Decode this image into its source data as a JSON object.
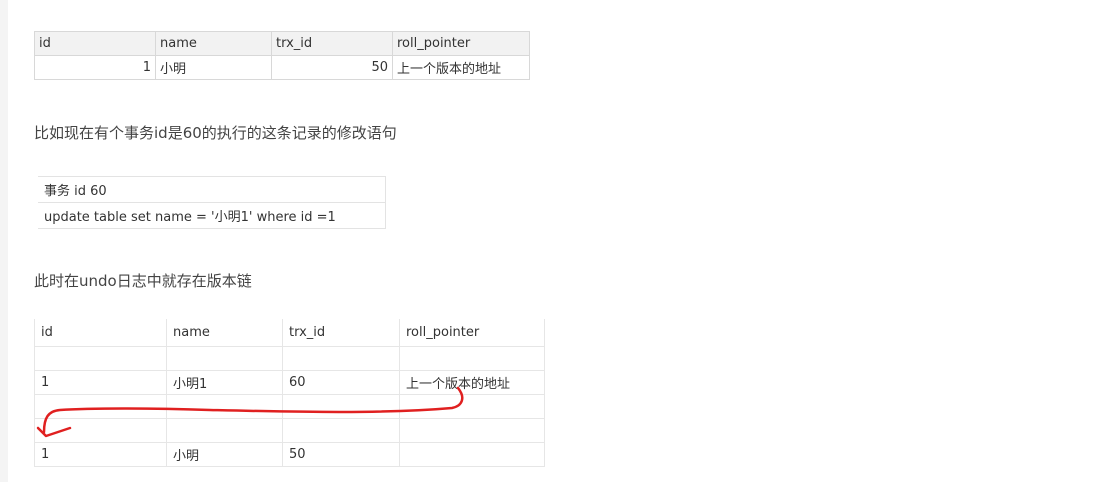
{
  "table1": {
    "headers": [
      "id",
      "name",
      "trx_id",
      "roll_pointer"
    ],
    "row": [
      "1",
      "小明",
      "50",
      "上一个版本的地址"
    ]
  },
  "paragraph1": "比如现在有个事务id是60的执行的这条记录的修改语句",
  "table2": {
    "rows": [
      "事务 id 60",
      "update table set name = '小明1' where id =1"
    ]
  },
  "paragraph2": "此时在undo日志中就存在版本链",
  "table3": {
    "headers": [
      "id",
      "name",
      "trx_id",
      "roll_pointer"
    ],
    "rows": [
      [
        "",
        "",
        "",
        ""
      ],
      [
        "1",
        "小明1",
        "60",
        "上一个版本的地址"
      ],
      [
        "",
        "",
        "",
        ""
      ],
      [
        "",
        "",
        "",
        ""
      ],
      [
        "1",
        "小明",
        "50",
        ""
      ]
    ]
  },
  "annotation": {
    "arrow_color": "#e02020",
    "arrow_meaning": "roll_pointer links to previous version row"
  }
}
